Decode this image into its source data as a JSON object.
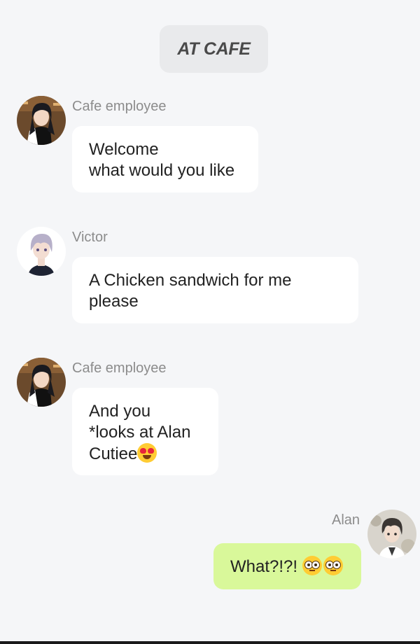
{
  "scene": {
    "label": "AT CAFE"
  },
  "messages": [
    {
      "sender": "Cafe employee",
      "lines": [
        "Welcome",
        "what would you like"
      ],
      "side": "left",
      "avatar_icon": "cafe-employee-avatar"
    },
    {
      "sender": "Victor",
      "lines": [
        "A Chicken sandwich for me",
        "please"
      ],
      "side": "left",
      "avatar_icon": "victor-avatar"
    },
    {
      "sender": "Cafe employee",
      "lines": [
        "And you",
        "*looks at Alan",
        "Cutiee"
      ],
      "trailing_emoji": "heart-eyes-emoji",
      "side": "left",
      "avatar_icon": "cafe-employee-avatar"
    },
    {
      "sender": "Alan",
      "lines": [
        "What?!?! "
      ],
      "trailing_emoji": "flushed-face-emoji x2",
      "side": "right",
      "avatar_icon": "alan-avatar"
    }
  ],
  "colors": {
    "background": "#f5f6f8",
    "bubble_left": "#ffffff",
    "bubble_right": "#d9f89a",
    "scene_pill": "#e9eaec",
    "sender_name": "#8c8c8c"
  }
}
